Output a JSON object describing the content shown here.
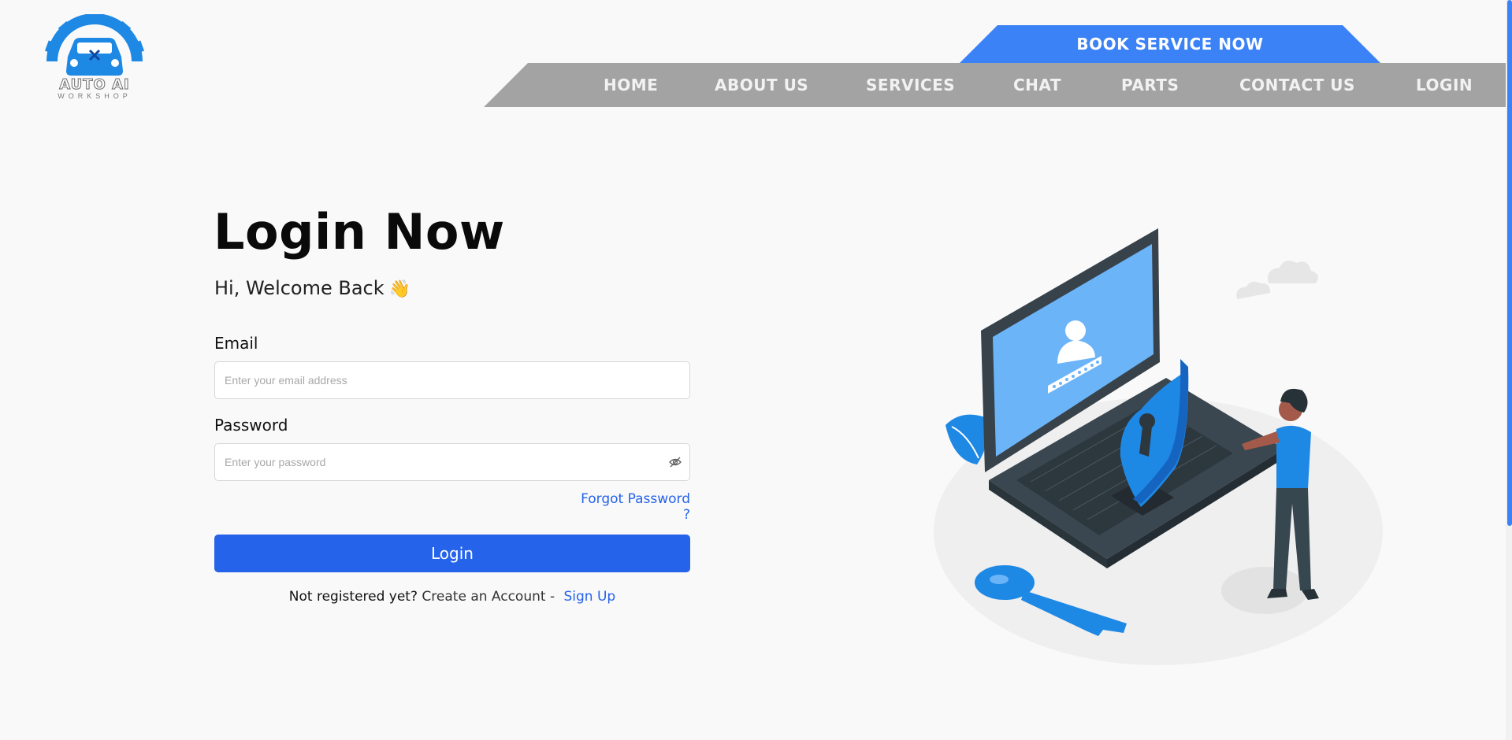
{
  "logo": {
    "brand": "AUTO AI",
    "tagline": "WORKSHOP",
    "icon": "car-gear-logo-icon"
  },
  "header": {
    "book_service": "BOOK SERVICE NOW",
    "nav": [
      "HOME",
      "ABOUT US",
      "SERVICES",
      "CHAT",
      "PARTS",
      "CONTACT US",
      "LOGIN"
    ]
  },
  "form": {
    "title": "Login Now",
    "welcome": "Hi, Welcome Back",
    "wave_emoji": "👋",
    "email_label": "Email",
    "email_placeholder": "Enter your email address",
    "email_value": "",
    "password_label": "Password",
    "password_placeholder": "Enter your password",
    "password_value": "",
    "forgot": "Forgot Password ?",
    "submit": "Login",
    "not_registered": "Not registered yet?",
    "create_account": "Create an Account -",
    "sign_up": "Sign Up"
  },
  "icons": {
    "toggle_password": "eye-off-icon",
    "illustration": "laptop-security-illustration"
  },
  "colors": {
    "accent": "#2563eb",
    "banner": "#3b82f6",
    "nav_bg": "#a3a3a3",
    "background": "#f9f9f9"
  }
}
